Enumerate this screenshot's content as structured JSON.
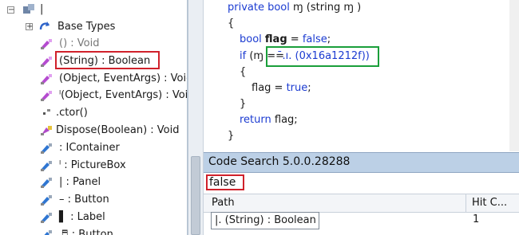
{
  "tree": {
    "root_label": "|",
    "base_types_label": "Base Types",
    "items": [
      {
        "label": "() : Void",
        "muted": true
      },
      {
        "label": "(String) : Boolean",
        "highlight": true
      },
      {
        "label": "(Object, EventArgs) : Void",
        "muted": false
      },
      {
        "label": "ˡ(Object, EventArgs) : Void",
        "muted": false
      },
      {
        "label": ".ctor()",
        "muted": false
      },
      {
        "label": "Dispose(Boolean) : Void",
        "muted": false
      },
      {
        "label": "   : IContainer",
        "muted": false
      },
      {
        "label": "ˡ : PictureBox",
        "muted": false
      },
      {
        "label": "| : Panel",
        "muted": false
      },
      {
        "label": "– : Button",
        "muted": false
      },
      {
        "label": "▌ : Label",
        "muted": false
      },
      {
        "label": "♬ : Button",
        "muted": false
      }
    ]
  },
  "code": {
    "line1_kw": "private bool",
    "line1_name": " ɱ (string ɱ )",
    "open1": "{",
    "bool_kw": "bool",
    "flag_name": "flag",
    "assign_false": " = ",
    "false_kw": "false",
    "semi": ";",
    "if_kw": "if",
    "if_rest": " (ɱ  ==",
    "call_text": "ˉ.ı. (0x16a1212f))",
    "open2": "{",
    "flag_assign": "flag = ",
    "true_kw": "true",
    "semi2": ";",
    "close2": "}",
    "return_kw": "return",
    "return_rest": " flag;",
    "close1": "}"
  },
  "code_search": {
    "title": "Code Search 5.0.0.28288",
    "query": "false",
    "col_path": "Path",
    "col_hits": "Hit C...",
    "result_path": "|.  (String) : Boolean",
    "result_hits": "1"
  }
}
